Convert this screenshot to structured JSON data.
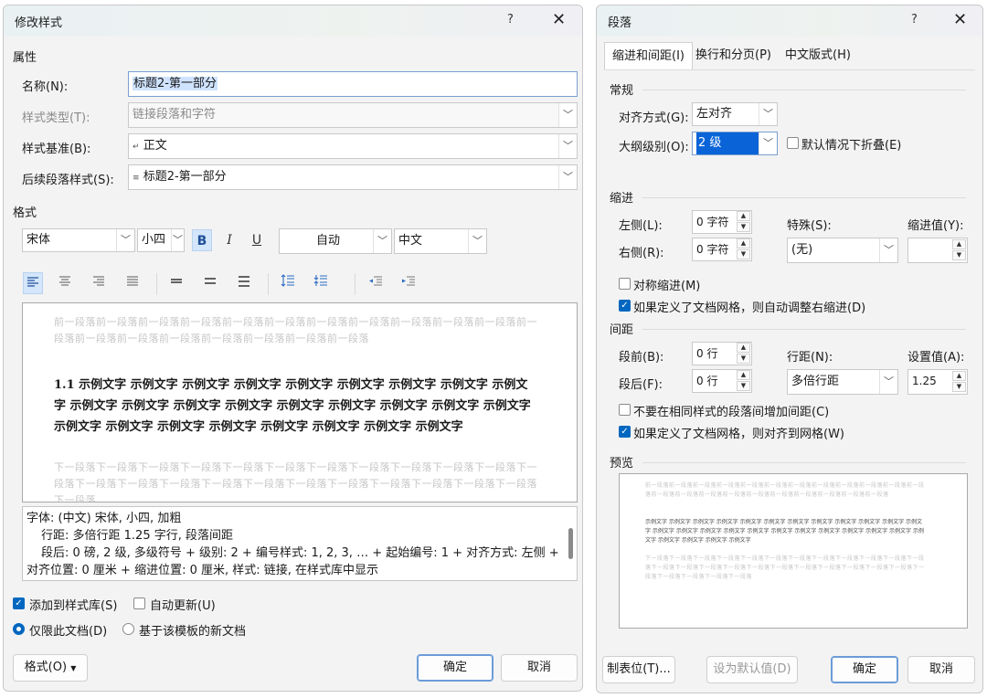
{
  "left": {
    "title": "修改样式",
    "help": "?",
    "close": "✕",
    "properties_header": "属性",
    "name_label": "名称(N):",
    "name_value": "标题2-第一部分",
    "style_type_label": "样式类型(T):",
    "style_type_value": "链接段落和字符",
    "based_on_label": "样式基准(B):",
    "based_on_icon": "↵",
    "based_on_value": "正文",
    "next_style_label": "后续段落样式(S):",
    "next_style_icon": "≡",
    "next_style_value": "标题2-第一部分",
    "format_header": "格式",
    "font_value": "宋体",
    "size_value": "小四",
    "bold": "B",
    "italic": "I",
    "underline": "U",
    "color_value": "自动",
    "lang_value": "中文",
    "preview_prev": "前一段落前一段落前一段落前一段落前一段落前一段落前一段落前一段落前一段落前一段落前一段落前一段落前一段落前一段落前一段落前一段落前一段落前一段落前一段落",
    "preview_sample": "1.1 示例文字 示例文字 示例文字 示例文字 示例文字 示例文字 示例文字 示例文字 示例文字 示例文字 示例文字 示例文字 示例文字 示例文字 示例文字 示例文字 示例文字 示例文字 示例文字 示例文字 示例文字 示例文字 示例文字 示例文字 示例文字 示例文字",
    "preview_next": "下一段落下一段落下一段落下一段落下一段落下一段落下一段落下一段落下一段落下一段落下一段落下一段落下一段落下一段落下一段落下一段落下一段落下一段落下一段落下一段落下一段落下一段落下一段落下一段落",
    "desc_line1": "字体: (中文) 宋体, 小四, 加粗",
    "desc_line2": "行距: 多倍行距 1.25 字行, 段落间距",
    "desc_line3": "段后: 0 磅, 2 级, 多级符号 + 级别: 2 + 编号样式: 1, 2, 3, … + 起始编号: 1 + 对齐方式: 左侧 +",
    "desc_line4": "对齐位置:  0 厘米 + 缩进位置:  0 厘米, 样式: 链接, 在样式库中显示",
    "add_to_gallery": "添加到样式库(S)",
    "auto_update": "自动更新(U)",
    "only_this_doc": "仅限此文档(D)",
    "new_docs_template": "基于该模板的新文档",
    "format_btn": "格式(O)",
    "ok": "确定",
    "cancel": "取消"
  },
  "right": {
    "title": "段落",
    "help": "?",
    "close": "✕",
    "tabs": [
      "缩进和间距(I)",
      "换行和分页(P)",
      "中文版式(H)"
    ],
    "general_header": "常规",
    "align_label": "对齐方式(G):",
    "align_value": "左对齐",
    "outline_label": "大纲级别(O):",
    "outline_value": "2 级",
    "collapse_default": "默认情况下折叠(E)",
    "indent_header": "缩进",
    "left_label": "左侧(L):",
    "left_value": "0 字符",
    "right_label": "右侧(R):",
    "right_value": "0 字符",
    "special_label": "特殊(S):",
    "special_value": "(无)",
    "indent_by_label": "缩进值(Y):",
    "indent_by_value": "",
    "mirror_indent": "对称缩进(M)",
    "auto_adjust_indent": "如果定义了文档网格，则自动调整右缩进(D)",
    "spacing_header": "间距",
    "before_label": "段前(B):",
    "before_value": "0 行",
    "after_label": "段后(F):",
    "after_value": "0 行",
    "line_spacing_label": "行距(N):",
    "line_spacing_value": "多倍行距",
    "at_label": "设置值(A):",
    "at_value": "1.25",
    "no_space_same_style": "不要在相同样式的段落间增加间距(C)",
    "snap_to_grid": "如果定义了文档网格，则对齐到网格(W)",
    "preview_header": "预览",
    "preview_prev": "前一段落前一段落前一段落前一段落前一段落前一段落前一段落前一段落前一段落前一段落前一段落前一段落前一段落前一段落前一段落前一段落前一段落前一段落前一段落前一段落前一段落前一段落",
    "preview_sample": "示例文字 示例文字 示例文字 示例文字 示例文字 示例文字 示例文字 示例文字 示例文字 示例文字 示例文字 示例文字 示例文字 示例文字 示例文字 示例文字 示例文字 示例文字 示例文字 示例文字 示例文字 示例文字 示例文字 示例文字 示例文字 示例文字 示例文字 示例文字",
    "preview_next": "下一段落下一段落下一段落下一段落下一段落下一段落下一段落下一段落下一段落下一段落下一段落下一段落下一段落下一段落下一段落下一段落下一段落下一段落下一段落下一段落下一段落下一段落下一段落下一段落下一段落下一段落下一段落下一段落",
    "tabs_btn": "制表位(T)...",
    "set_default": "设为默认值(D)",
    "ok": "确定",
    "cancel": "取消"
  }
}
